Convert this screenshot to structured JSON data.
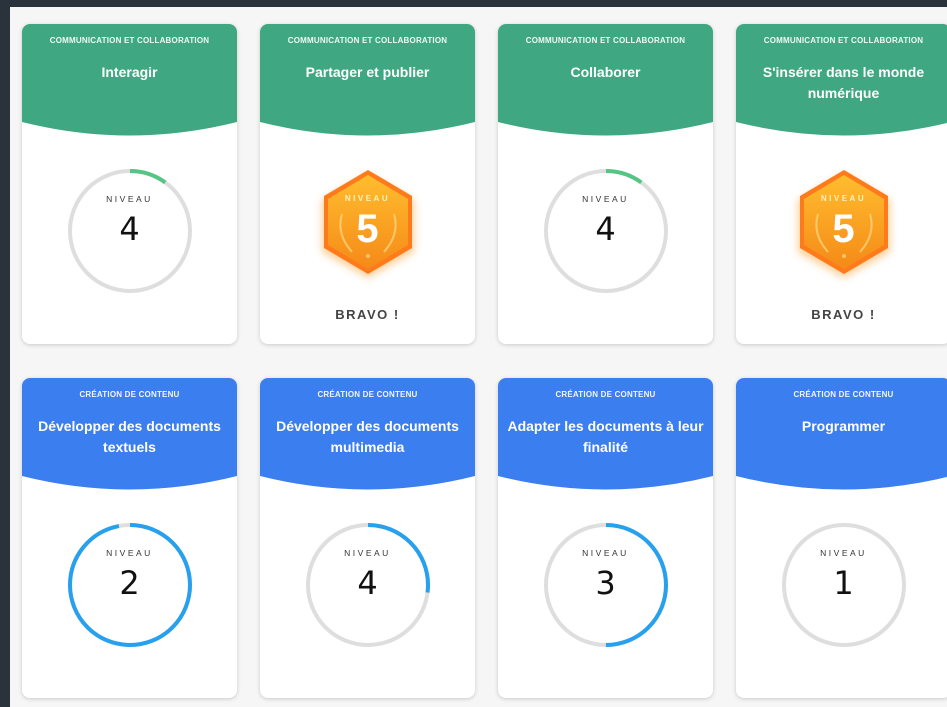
{
  "colors": {
    "communication_header": "#3fa882",
    "creation_header": "#3b7ef0",
    "communication_progress": "#55c586",
    "creation_progress": "#27a0ee",
    "ring_track": "#dedede",
    "badge_orange": "#f7961e"
  },
  "icons": {
    "badge": "hexagon-laurel-badge-icon",
    "ring": "progress-ring-icon"
  },
  "cards": [
    {
      "category": "COMMUNICATION ET COLLABORATION",
      "title": "Interagir",
      "niveau_label": "NIVEAU",
      "niveau_value": "4",
      "progress": 0.1,
      "completed": false
    },
    {
      "category": "COMMUNICATION ET COLLABORATION",
      "title": "Partager et publier",
      "niveau_label": "NIVEAU",
      "niveau_value": "5",
      "progress": 1,
      "completed": true,
      "completed_text": "BRAVO !"
    },
    {
      "category": "COMMUNICATION ET COLLABORATION",
      "title": "Collaborer",
      "niveau_label": "NIVEAU",
      "niveau_value": "4",
      "progress": 0.1,
      "completed": false
    },
    {
      "category": "COMMUNICATION ET COLLABORATION",
      "title": "S'insérer dans le monde numérique",
      "niveau_label": "NIVEAU",
      "niveau_value": "5",
      "progress": 1,
      "completed": true,
      "completed_text": "BRAVO !"
    },
    {
      "category": "CRÉATION DE CONTENU",
      "title": "Développer des documents textuels",
      "niveau_label": "NIVEAU",
      "niveau_value": "2",
      "progress": 0.97,
      "completed": false
    },
    {
      "category": "CRÉATION DE CONTENU",
      "title": "Développer des documents multimedia",
      "niveau_label": "NIVEAU",
      "niveau_value": "4",
      "progress": 0.27,
      "completed": false
    },
    {
      "category": "CRÉATION DE CONTENU",
      "title": "Adapter les documents à leur finalité",
      "niveau_label": "NIVEAU",
      "niveau_value": "3",
      "progress": 0.5,
      "completed": false
    },
    {
      "category": "CRÉATION DE CONTENU",
      "title": "Programmer",
      "niveau_label": "NIVEAU",
      "niveau_value": "1",
      "progress": 0,
      "completed": false
    }
  ]
}
